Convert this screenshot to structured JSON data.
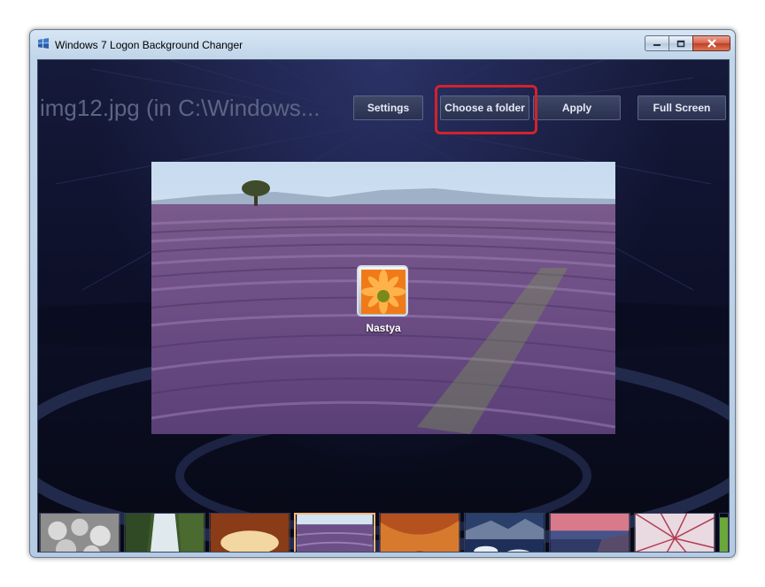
{
  "window": {
    "title": "Windows 7 Logon Background Changer",
    "icon": "windows-flag-icon"
  },
  "controls": {
    "minimize_icon": "minimize-icon",
    "maximize_icon": "maximize-icon",
    "close_icon": "close-icon"
  },
  "header": {
    "current_file": "img12.jpg (in C:\\Windows..."
  },
  "toolbar": {
    "settings_label": "Settings",
    "choose_folder_label": "Choose a folder",
    "apply_label": "Apply",
    "fullscreen_label": "Full Screen"
  },
  "preview": {
    "user_name": "Nastya",
    "avatar": "orange-flower-icon"
  },
  "thumbnails": {
    "items": [
      "smiley-stones",
      "waterfall",
      "rock-arch",
      "lavender-field",
      "red-canyon",
      "icy-lake",
      "sunset-shore",
      "palm-frond",
      "green-leaf"
    ],
    "selected_index": 3
  },
  "colors": {
    "accent_highlight": "#d2232a",
    "selected_border": "#f2b77c",
    "background": "#0d1029"
  }
}
